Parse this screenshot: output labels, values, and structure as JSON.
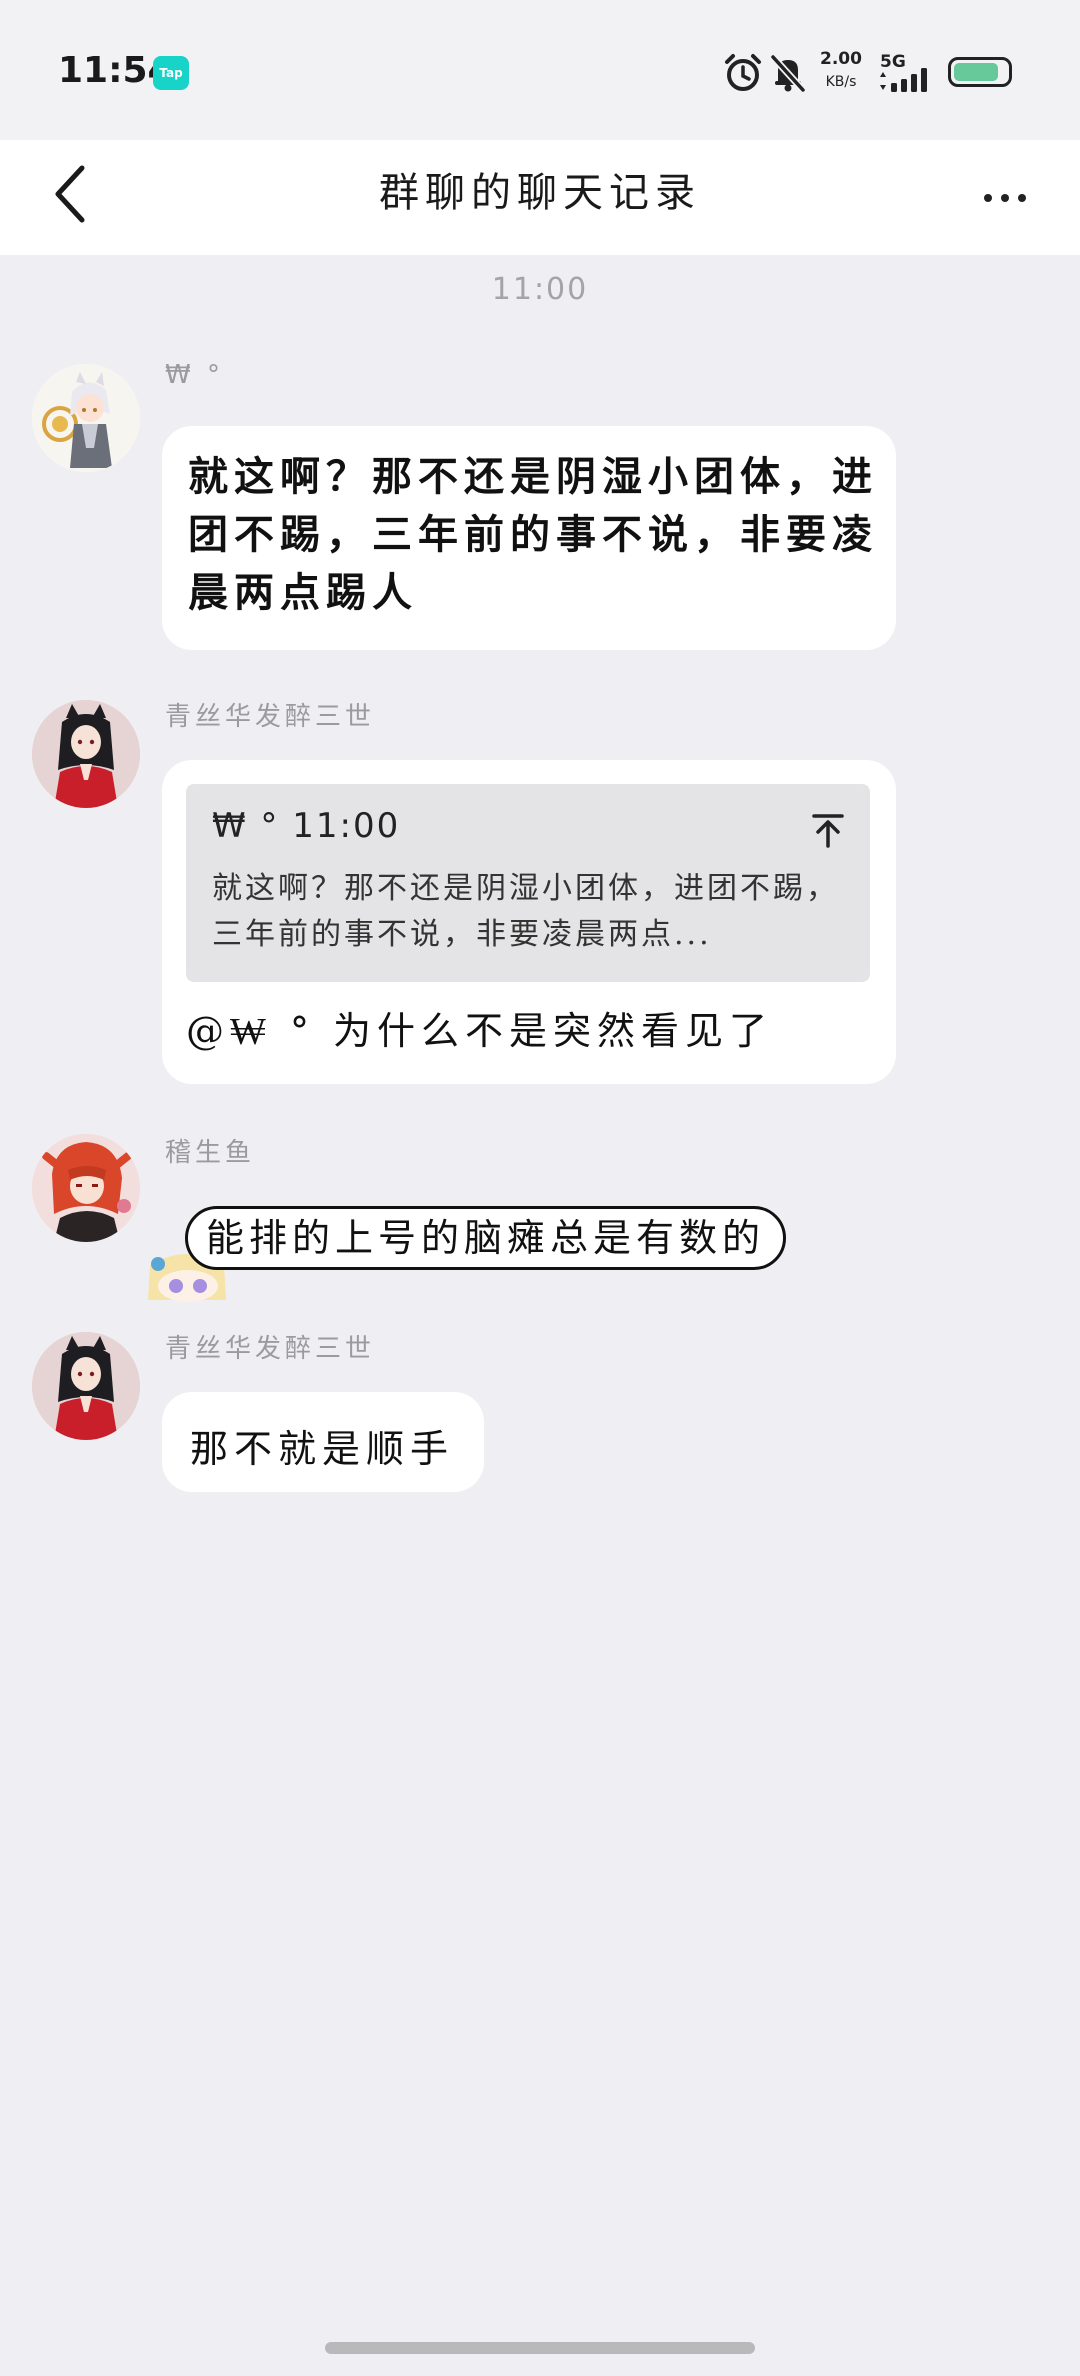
{
  "status_bar": {
    "time": "11:54",
    "app_badge": "Tap",
    "net_speed_value": "2.00",
    "net_speed_unit": "KB/s",
    "net_type": "5G",
    "battery_level": 0.85
  },
  "nav": {
    "title": "群聊的聊天记录"
  },
  "timestamp": "11:00",
  "messages": [
    {
      "sender": "₩ °",
      "text": "就这啊？那不还是阴湿小团体，进团不踢，三年前的事不说，非要凌晨两点踢人"
    },
    {
      "sender": "青丝华发醉三世",
      "quote": {
        "header": "₩ ° 11:00",
        "text": "就这啊？那不还是阴湿小团体，进团不踢，三年前的事不说，非要凌晨两点..."
      },
      "text": "@₩ ° 为什么不是突然看见了"
    },
    {
      "sender": "稽生鱼",
      "text": "能排的上号的脑瘫总是有数的"
    },
    {
      "sender": "青丝华发醉三世",
      "text": "那不就是顺手"
    }
  ],
  "colors": {
    "background": "#efeff3",
    "bubble": "#ffffff",
    "quote_bg": "#e4e4e6",
    "accent_badge": "#18d4c8",
    "battery": "#67c89a"
  }
}
